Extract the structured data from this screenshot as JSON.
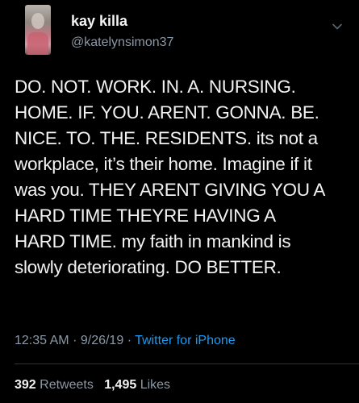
{
  "user": {
    "display_name": "kay killa",
    "handle": "@katelynsimon37"
  },
  "tweet": {
    "text": "DO. NOT. WORK. IN. A. NURSING.\nHOME. IF. YOU. ARENT. GONNA. BE.\nNICE. TO. THE. RESIDENTS. its not a\nworkplace, it’s their home. Imagine if it\nwas you. THEY ARENT GIVING YOU A\nHARD TIME THEYRE HAVING A\nHARD TIME. my faith in mankind is\nslowly deteriorating. DO BETTER.",
    "time": "12:35 AM",
    "date": "9/26/19",
    "separator": "·",
    "source": "Twitter for iPhone"
  },
  "stats": {
    "retweets_count": "392",
    "retweets_label": "Retweets",
    "likes_count": "1,495",
    "likes_label": "Likes"
  },
  "icons": {
    "menu": "chevron-down-icon"
  },
  "colors": {
    "background": "#000000",
    "text": "#f2f2f2",
    "secondary": "#8b98a5",
    "link": "#1d9bf0"
  }
}
